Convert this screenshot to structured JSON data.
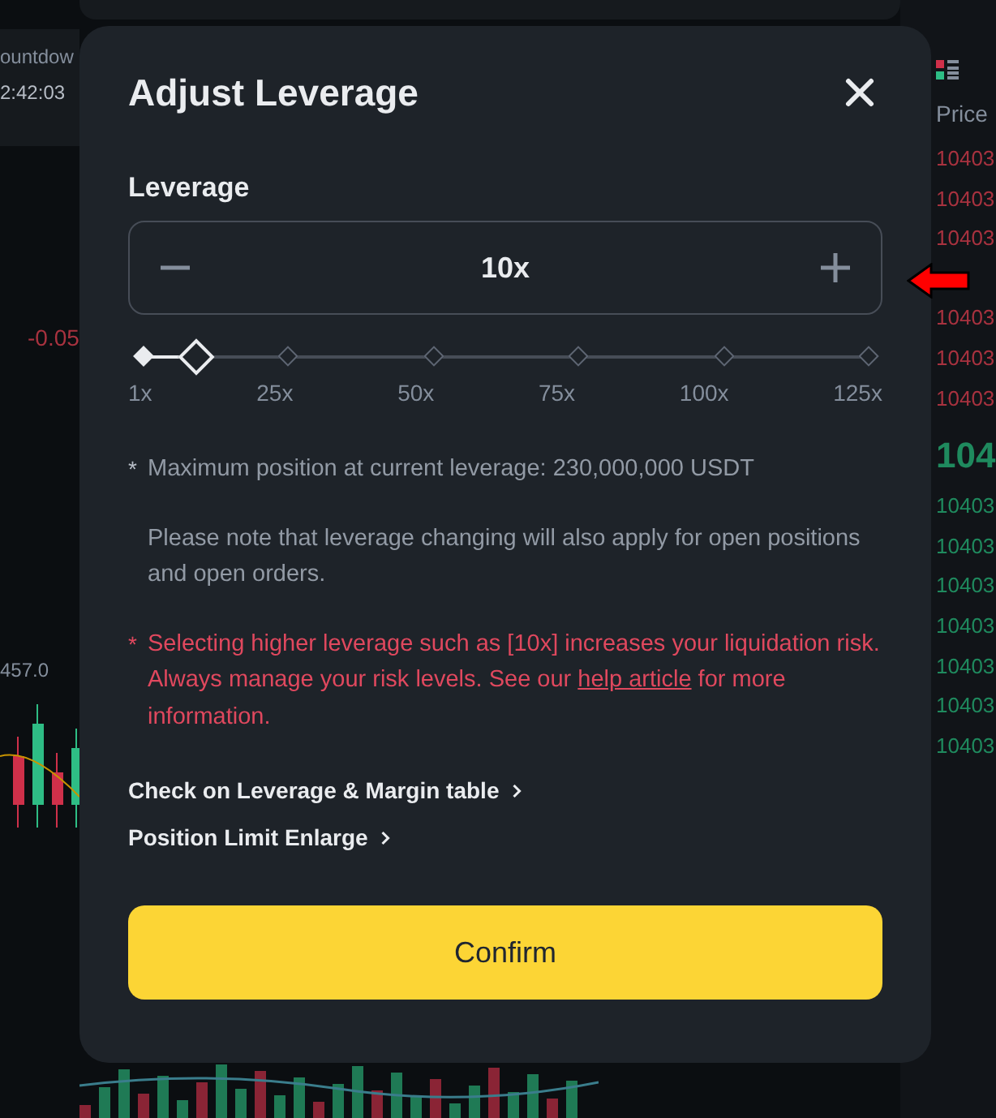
{
  "background": {
    "countdown_label": "ountdow",
    "countdown_time": "2:42:03",
    "funding_rate": "-0.05",
    "price_label": "457.0",
    "order_book": {
      "header": "Price",
      "asks": [
        "10403",
        "10403",
        "10403",
        "10403",
        "10403",
        "10403"
      ],
      "last_price": "104",
      "bids": [
        "10403",
        "10403",
        "10403",
        "10403",
        "10403",
        "10403",
        "10403"
      ]
    }
  },
  "dialog": {
    "title": "Adjust Leverage",
    "field_label": "Leverage",
    "value": "10x",
    "level": 0.072,
    "marks": [
      "1x",
      "25x",
      "50x",
      "75x",
      "100x",
      "125x"
    ],
    "notes": [
      {
        "kind": "note",
        "marker": "*",
        "text": "Maximum position at current leverage: 230,000,000 USDT"
      },
      {
        "kind": "note",
        "text": "Please note that leverage changing will also apply for open positions and open orders."
      },
      {
        "kind": "warning",
        "marker": "*",
        "text": "Selecting higher leverage such as [10x] increases your liquidation risk. Always manage your risk levels. See our ",
        "link": "help article",
        "after": " for more information."
      }
    ],
    "links": [
      "Check on Leverage & Margin table",
      "Position Limit Enlarge"
    ],
    "confirm": "Confirm"
  }
}
